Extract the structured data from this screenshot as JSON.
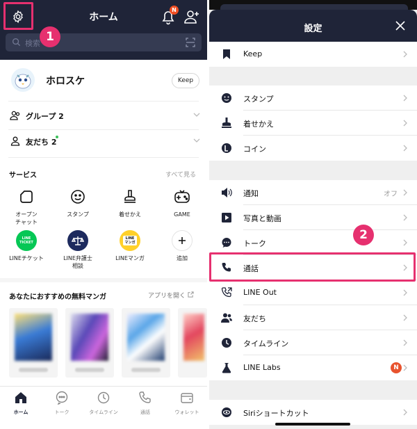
{
  "left": {
    "header_title": "ホーム",
    "bell_badge": "N",
    "search_placeholder": "検索",
    "step1": "1",
    "profile": {
      "name": "ホロスケ",
      "keep_label": "Keep"
    },
    "groups_label": "グループ 2",
    "friends_label": "友だち 2",
    "services": {
      "title": "サービス",
      "see_all": "すべて見る",
      "items": [
        {
          "label": "オープン\nチャット",
          "icon": "open-chat-icon"
        },
        {
          "label": "スタンプ",
          "icon": "sticker-icon"
        },
        {
          "label": "着せかえ",
          "icon": "theme-icon"
        },
        {
          "label": "GAME",
          "icon": "game-icon"
        },
        {
          "label": "LINEチケット",
          "icon": "line-ticket-icon",
          "badge_text": "LINE\nTICKET"
        },
        {
          "label": "LINE弁護士\n相談",
          "icon": "lawyer-icon"
        },
        {
          "label": "LINEマンガ",
          "icon": "manga-icon",
          "badge_text": "LINE\nマンガ"
        },
        {
          "label": "追加",
          "icon": "add-icon"
        }
      ]
    },
    "manga": {
      "title": "あなたにおすすめの無料マンガ",
      "open_app": "アプリを開く"
    },
    "tabs": [
      {
        "label": "ホーム",
        "icon": "home-icon",
        "active": true
      },
      {
        "label": "トーク",
        "icon": "chat-icon"
      },
      {
        "label": "タイムライン",
        "icon": "timeline-icon"
      },
      {
        "label": "通話",
        "icon": "phone-icon"
      },
      {
        "label": "ウォレット",
        "icon": "wallet-icon"
      }
    ]
  },
  "right": {
    "header_title": "設定",
    "step2": "2",
    "rows": [
      {
        "label": "Keep",
        "icon": "bookmark-icon"
      },
      {
        "label": "スタンプ",
        "icon": "sticker-icon"
      },
      {
        "label": "着せかえ",
        "icon": "theme-icon"
      },
      {
        "label": "コイン",
        "icon": "coin-icon"
      },
      {
        "label": "通知",
        "icon": "speaker-icon",
        "value": "オフ"
      },
      {
        "label": "写真と動画",
        "icon": "video-icon"
      },
      {
        "label": "トーク",
        "icon": "chat-bubble-icon"
      },
      {
        "label": "通話",
        "icon": "phone-icon"
      },
      {
        "label": "LINE Out",
        "icon": "line-out-icon"
      },
      {
        "label": "友だち",
        "icon": "friends-icon"
      },
      {
        "label": "タイムライン",
        "icon": "clock-icon"
      },
      {
        "label": "LINE Labs",
        "icon": "flask-icon",
        "badge": "N"
      },
      {
        "label": "Siriショートカット",
        "icon": "siri-icon"
      }
    ]
  },
  "colors": {
    "header": "#1f2438",
    "highlight": "#e6306f",
    "badge": "#f04e23"
  }
}
